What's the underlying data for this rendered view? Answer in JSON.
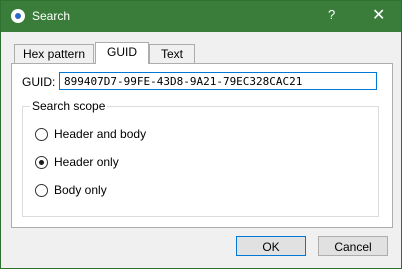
{
  "window": {
    "title": "Search",
    "help": "?",
    "close": "✕"
  },
  "tabs": [
    {
      "label": "Hex pattern",
      "active": false
    },
    {
      "label": "GUID",
      "active": true
    },
    {
      "label": "Text",
      "active": false
    }
  ],
  "guid": {
    "label": "GUID:",
    "value": "899407D7-99FE-43D8-9A21-79EC328CAC21"
  },
  "search_scope": {
    "legend": "Search scope",
    "options": [
      {
        "label": "Header and body",
        "checked": false
      },
      {
        "label": "Header only",
        "checked": true
      },
      {
        "label": "Body only",
        "checked": false
      }
    ]
  },
  "buttons": {
    "ok": "OK",
    "cancel": "Cancel"
  }
}
